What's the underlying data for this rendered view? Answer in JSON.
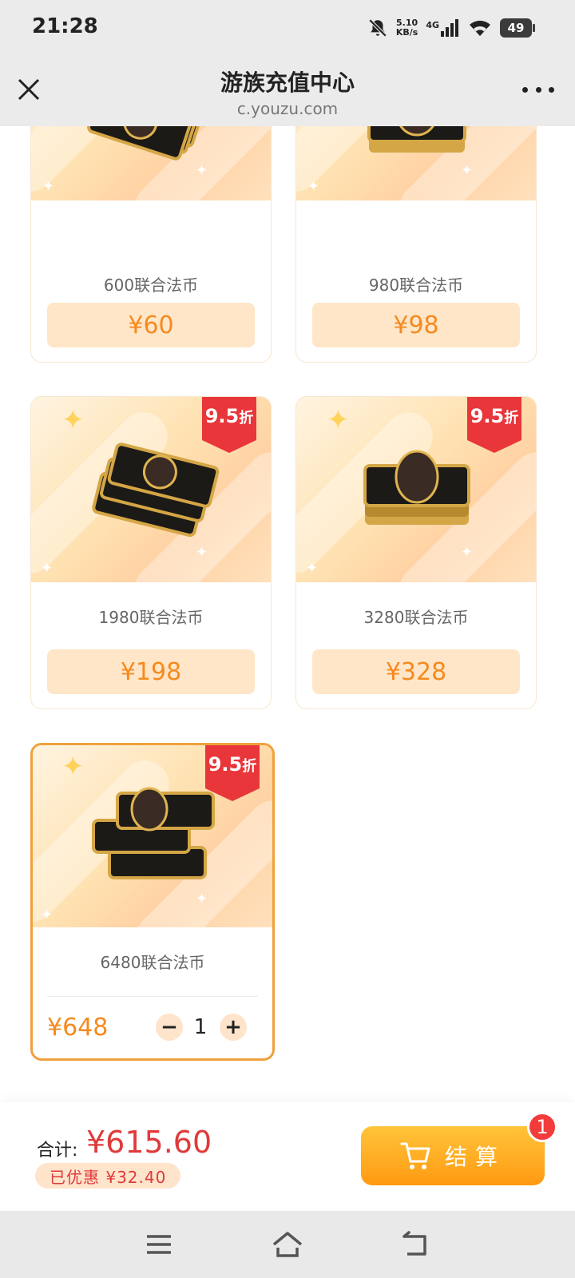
{
  "status_bar": {
    "time": "21:28",
    "net_speed_value": "5.10",
    "net_speed_unit": "KB/s",
    "network": "4G",
    "battery": "49"
  },
  "title_bar": {
    "title": "游族充值中心",
    "url": "c.youzu.com"
  },
  "products": [
    {
      "name": "600联合法币",
      "price": "¥60",
      "discount": ""
    },
    {
      "name": "980联合法币",
      "price": "¥98",
      "discount": ""
    },
    {
      "name": "1980联合法币",
      "price": "¥198",
      "discount_num": "9.5",
      "discount_unit": "折"
    },
    {
      "name": "3280联合法币",
      "price": "¥328",
      "discount_num": "9.5",
      "discount_unit": "折"
    },
    {
      "name": "6480联合法币",
      "price": "¥648",
      "discount_num": "9.5",
      "discount_unit": "折",
      "quantity": "1",
      "selected": true
    }
  ],
  "qty_controls": {
    "minus": "−",
    "plus": "+"
  },
  "footer": {
    "total_label": "合计:",
    "total_value": "¥615.60",
    "saved_text": "已优惠 ¥32.40",
    "checkout_label": "结算",
    "cart_count": "1"
  },
  "colors": {
    "accent_orange": "#f58a1f",
    "price_red": "#e03a3a",
    "discount_red": "#e8363b",
    "selected_border": "#f0a13d"
  },
  "icons": [
    "bell-off-icon",
    "signal-icon",
    "wifi-icon",
    "battery-icon",
    "close-icon",
    "more-icon",
    "sparkle-icon",
    "coin-stack-icon",
    "cart-icon",
    "menu-icon",
    "home-icon",
    "back-icon"
  ]
}
